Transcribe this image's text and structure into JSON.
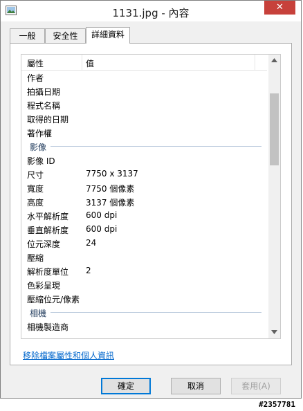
{
  "window": {
    "title": "1131.jpg - 內容",
    "close_glyph": "✕"
  },
  "tabs": [
    {
      "label": "一般"
    },
    {
      "label": "安全性"
    },
    {
      "label": "詳細資料"
    }
  ],
  "list": {
    "header": {
      "name": "屬性",
      "value": "值"
    },
    "rows": [
      {
        "name": "作者",
        "value": ""
      },
      {
        "name": "拍攝日期",
        "value": ""
      },
      {
        "name": "程式名稱",
        "value": ""
      },
      {
        "name": "取得的日期",
        "value": ""
      },
      {
        "name": "著作權",
        "value": ""
      }
    ],
    "group_image": "影像",
    "image_rows": [
      {
        "name": "影像 ID",
        "value": ""
      },
      {
        "name": "尺寸",
        "value": "7750 x 3137"
      },
      {
        "name": "寬度",
        "value": "7750 個像素"
      },
      {
        "name": "高度",
        "value": "3137 個像素"
      },
      {
        "name": "水平解析度",
        "value": "600 dpi"
      },
      {
        "name": "垂直解析度",
        "value": "600 dpi"
      },
      {
        "name": "位元深度",
        "value": "24"
      },
      {
        "name": "壓縮",
        "value": ""
      },
      {
        "name": "解析度單位",
        "value": "2"
      },
      {
        "name": "色彩呈現",
        "value": ""
      },
      {
        "name": "壓縮位元/像素",
        "value": ""
      }
    ],
    "group_camera": "相機",
    "camera_rows": [
      {
        "name": "相機製造商",
        "value": ""
      }
    ]
  },
  "remove_link": "移除檔案屬性和個人資訊",
  "buttons": {
    "ok": "確定",
    "cancel": "取消",
    "apply": "套用(A)"
  },
  "watermark": "#2357781"
}
